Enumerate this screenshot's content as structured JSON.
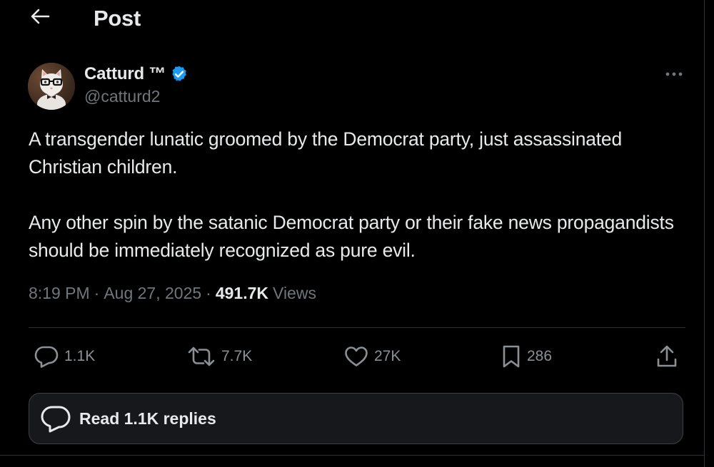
{
  "header": {
    "back_icon": "arrow-left-icon",
    "title": "Post"
  },
  "author": {
    "display_name": "Catturd ™",
    "handle": "@catturd2",
    "verified_icon": "verified-badge-icon",
    "verified_color": "#1d9bf0",
    "more_icon": "more-dots-icon"
  },
  "post": {
    "paragraphs": [
      "A transgender lunatic groomed by the Democrat party, just assassinated Christian children.",
      "Any other spin by the satanic Democrat party or their fake news propagandists should be immediately recognized as pure evil."
    ],
    "time": "8:19 PM",
    "separator": "·",
    "date": "Aug 27, 2025",
    "views_count": "491.7K",
    "views_label": "Views"
  },
  "actions": {
    "reply": {
      "icon": "reply-icon",
      "count": "1.1K"
    },
    "repost": {
      "icon": "repost-icon",
      "count": "7.7K"
    },
    "like": {
      "icon": "heart-icon",
      "count": "27K"
    },
    "bookmark": {
      "icon": "bookmark-icon",
      "count": "286"
    },
    "share": {
      "icon": "share-icon"
    }
  },
  "replies_button": {
    "icon": "speech-bubble-icon",
    "label": "Read 1.1K replies"
  },
  "colors": {
    "background": "#000000",
    "text_primary": "#e7e9ea",
    "text_secondary": "#71767b",
    "border": "#2f3336",
    "accent": "#1d9bf0"
  }
}
